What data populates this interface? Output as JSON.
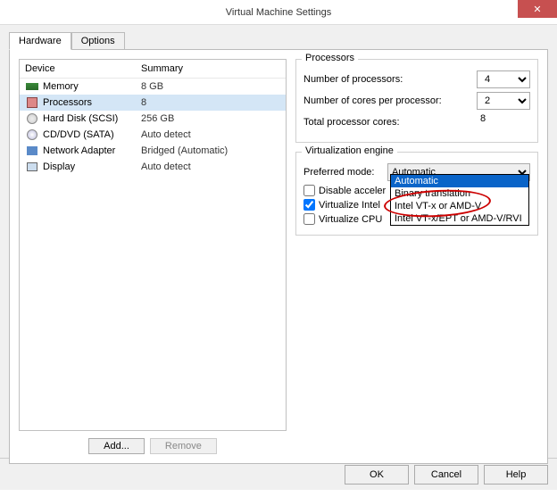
{
  "title": "Virtual Machine Settings",
  "tabs": {
    "hardware": "Hardware",
    "options": "Options"
  },
  "headers": {
    "device": "Device",
    "summary": "Summary"
  },
  "devices": [
    {
      "name": "Memory",
      "summary": "8 GB",
      "icon": "mem"
    },
    {
      "name": "Processors",
      "summary": "8",
      "icon": "cpu",
      "selected": true
    },
    {
      "name": "Hard Disk (SCSI)",
      "summary": "256 GB",
      "icon": "hdd"
    },
    {
      "name": "CD/DVD (SATA)",
      "summary": "Auto detect",
      "icon": "cd"
    },
    {
      "name": "Network Adapter",
      "summary": "Bridged (Automatic)",
      "icon": "net"
    },
    {
      "name": "Display",
      "summary": "Auto detect",
      "icon": "disp"
    }
  ],
  "buttons": {
    "add": "Add...",
    "remove": "Remove",
    "ok": "OK",
    "cancel": "Cancel",
    "help": "Help"
  },
  "processors": {
    "group": "Processors",
    "num_label": "Number of processors:",
    "num_value": "4",
    "cores_label": "Number of cores per processor:",
    "cores_value": "2",
    "total_label": "Total processor cores:",
    "total_value": "8"
  },
  "ve": {
    "group": "Virtualization engine",
    "mode_label": "Preferred mode:",
    "mode_value": "Automatic",
    "options": [
      "Automatic",
      "Binary translation",
      "Intel VT-x or AMD-V",
      "Intel VT-x/EPT or AMD-V/RVI"
    ],
    "check1_label": "Disable acceler",
    "check1_on": false,
    "check2_label": "Virtualize Intel",
    "check2_on": true,
    "check3_label": "Virtualize CPU",
    "check3_on": false
  }
}
